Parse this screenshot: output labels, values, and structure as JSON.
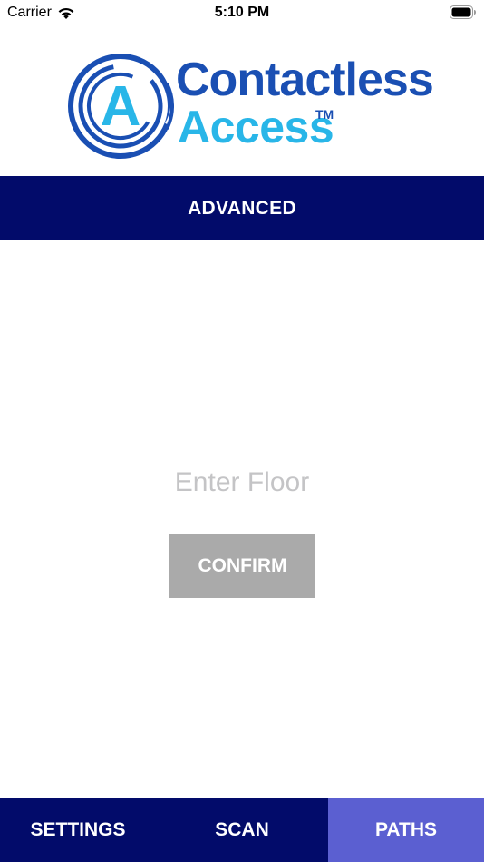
{
  "status_bar": {
    "carrier": "Carrier",
    "time": "5:10 PM",
    "icons": [
      "wifi-icon",
      "battery-icon"
    ]
  },
  "logo": {
    "mark_letter": "A",
    "line1": "Contactless",
    "line2": "Access",
    "trademark": "TM",
    "colors": {
      "dark_blue": "#1a4fb3",
      "light_blue": "#29b6e8"
    }
  },
  "header": {
    "title": "ADVANCED",
    "background": "#020b6a"
  },
  "main": {
    "floor_input": {
      "value": "",
      "placeholder": "Enter Floor"
    },
    "confirm_label": "CONFIRM"
  },
  "tabs": [
    {
      "label": "SETTINGS",
      "selected": false
    },
    {
      "label": "SCAN",
      "selected": false
    },
    {
      "label": "PATHS",
      "selected": true
    }
  ],
  "colors": {
    "tab_background": "#020b6a",
    "tab_selected": "#5b5fd1",
    "confirm_button": "#aaaaaa"
  }
}
